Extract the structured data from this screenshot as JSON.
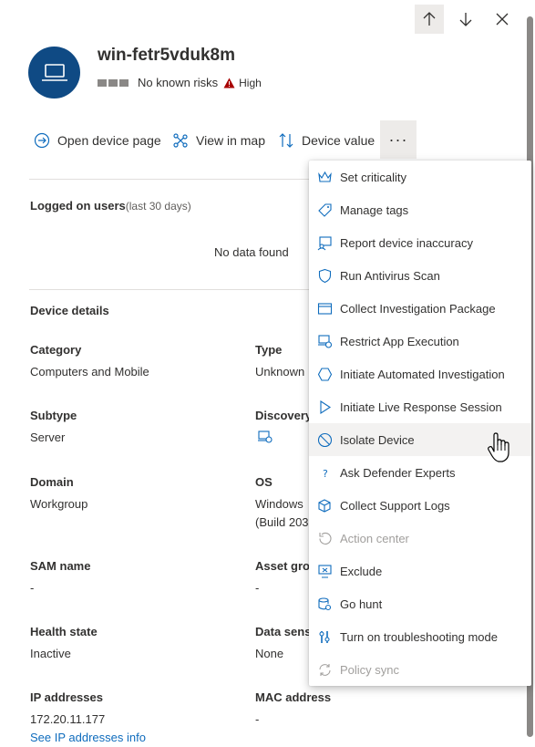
{
  "device": {
    "name": "win-fetr5vduk8m",
    "risk_text": "No known risks",
    "severity": "High"
  },
  "actions": {
    "open_device_page": "Open device page",
    "view_in_map": "View in map",
    "device_value": "Device value",
    "more": "···"
  },
  "logged_on_users": {
    "label": "Logged on users",
    "period": "(last 30 days)",
    "empty": "No data found"
  },
  "device_details": {
    "title": "Device details",
    "fields": {
      "category_label": "Category",
      "category_value": "Computers and Mobile",
      "type_label": "Type",
      "type_value": "Unknown",
      "subtype_label": "Subtype",
      "subtype_value": "Server",
      "discovery_label": "Discovery",
      "domain_label": "Domain",
      "domain_value": "Workgroup",
      "os_label": "OS",
      "os_value_line1": "Windows",
      "os_value_line2": "(Build 203",
      "sam_label": "SAM name",
      "sam_value": "-",
      "asset_label": "Asset gro",
      "asset_value": "-",
      "health_label": "Health state",
      "health_value": "Inactive",
      "data_sens_label": "Data sens",
      "data_sens_value": "None",
      "ip_label": "IP addresses",
      "ip_value": "172.20.11.177",
      "ip_link": "See IP addresses info",
      "mac_label": "MAC address",
      "mac_value": "-"
    }
  },
  "menu": {
    "items": [
      {
        "label": "Set criticality",
        "icon": "crown-icon",
        "disabled": false
      },
      {
        "label": "Manage tags",
        "icon": "tag-icon",
        "disabled": false
      },
      {
        "label": "Report device inaccuracy",
        "icon": "report-icon",
        "disabled": false
      },
      {
        "label": "Run Antivirus Scan",
        "icon": "shield-icon",
        "disabled": false
      },
      {
        "label": "Collect Investigation Package",
        "icon": "package-icon",
        "disabled": false
      },
      {
        "label": "Restrict App Execution",
        "icon": "restrict-icon",
        "disabled": false
      },
      {
        "label": "Initiate Automated Investigation",
        "icon": "hexagon-icon",
        "disabled": false
      },
      {
        "label": "Initiate Live Response Session",
        "icon": "play-icon",
        "disabled": false
      },
      {
        "label": "Isolate Device",
        "icon": "block-icon",
        "disabled": false
      },
      {
        "label": "Ask Defender Experts",
        "icon": "question-icon",
        "disabled": false
      },
      {
        "label": "Collect Support Logs",
        "icon": "logs-icon",
        "disabled": false
      },
      {
        "label": "Action center",
        "icon": "history-icon",
        "disabled": true
      },
      {
        "label": "Exclude",
        "icon": "exclude-icon",
        "disabled": false
      },
      {
        "label": "Go hunt",
        "icon": "hunt-icon",
        "disabled": false
      },
      {
        "label": "Turn on troubleshooting mode",
        "icon": "wrench-icon",
        "disabled": false
      },
      {
        "label": "Policy sync",
        "icon": "sync-icon",
        "disabled": true
      }
    ]
  },
  "colors": {
    "accent": "#0f6cbd",
    "avatar_bg": "#0f4a84",
    "severity_red": "#a80000"
  }
}
